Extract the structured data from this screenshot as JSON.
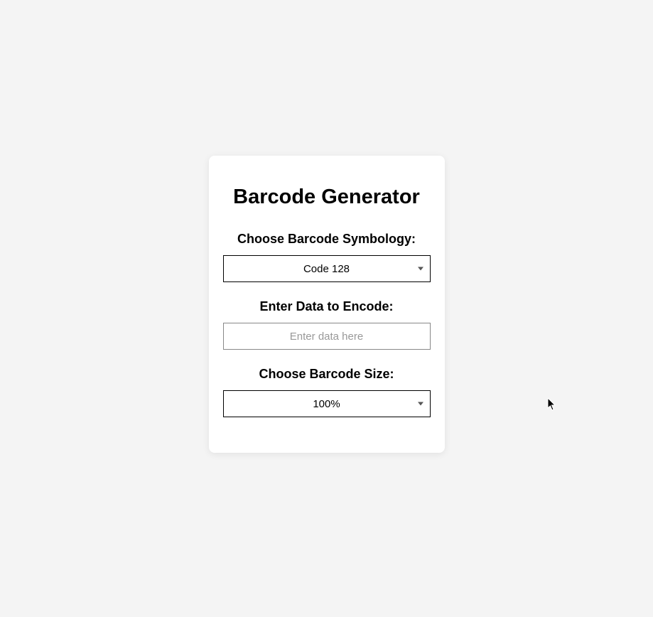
{
  "title": "Barcode Generator",
  "symbology": {
    "label": "Choose Barcode Symbology:",
    "selected": "Code 128"
  },
  "data_input": {
    "label": "Enter Data to Encode:",
    "placeholder": "Enter data here",
    "value": ""
  },
  "size": {
    "label": "Choose Barcode Size:",
    "selected": "100%"
  }
}
